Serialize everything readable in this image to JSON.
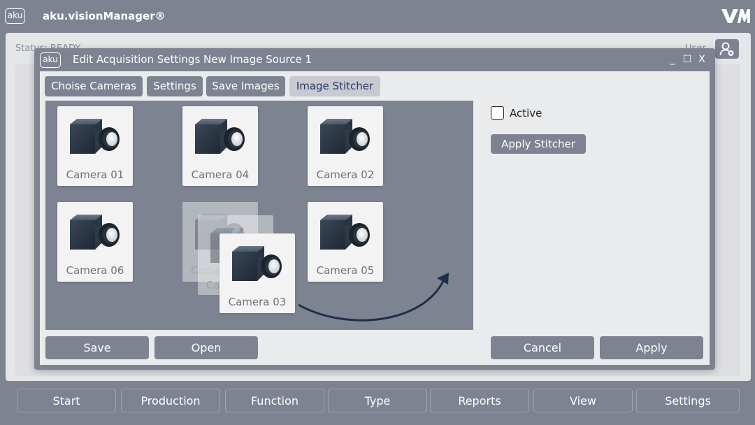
{
  "app": {
    "logo_text": "aku",
    "title": "aku.visionManager®",
    "brand_mark": "VM"
  },
  "status": {
    "text": "Status: READY",
    "user_label": "User"
  },
  "dialog": {
    "logo_text": "aku",
    "title": "Edit Acquisition Settings New Image Source 1",
    "controls": {
      "minimize": "_",
      "maximize": "☐",
      "close": "X"
    },
    "tabs": [
      {
        "label": "Choise Cameras",
        "active": false
      },
      {
        "label": "Settings",
        "active": false
      },
      {
        "label": "Save Images",
        "active": false
      },
      {
        "label": "Image Stitcher",
        "active": true
      }
    ],
    "cameras": [
      {
        "label": "Camera 01"
      },
      {
        "label": "Camera 04"
      },
      {
        "label": "Camera 02"
      },
      {
        "label": "Camera 06"
      },
      {
        "label": "Camera 03",
        "state": "dragging"
      },
      {
        "label": "Camera 05"
      }
    ],
    "ghost_labels": [
      "Came",
      "Ca"
    ],
    "active_label": "Active",
    "active_checked": false,
    "apply_stitcher_label": "Apply Stitcher",
    "save_label": "Save",
    "open_label": "Open",
    "cancel_label": "Cancel",
    "apply_label": "Apply"
  },
  "nav": [
    "Start",
    "Production",
    "Function",
    "Type",
    "Reports",
    "View",
    "Settings"
  ],
  "colors": {
    "panel": "#7d8391",
    "surface": "#eaebed",
    "active_tab_text": "#283a66"
  }
}
